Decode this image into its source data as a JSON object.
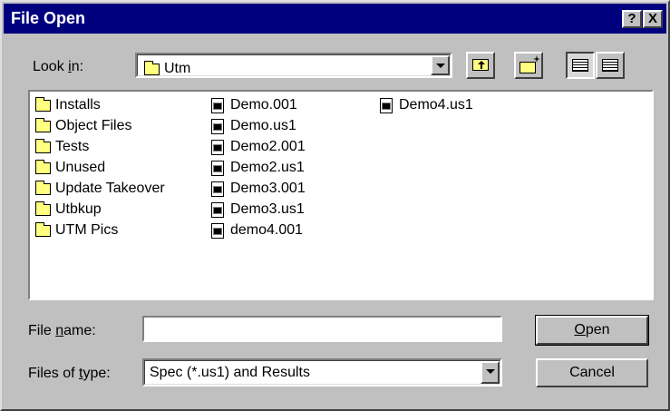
{
  "window": {
    "title": "File Open",
    "help_button": "?",
    "close_button": "X"
  },
  "look_in": {
    "label_pre": "Look ",
    "label_accel": "i",
    "label_post": "n:",
    "value": "Utm"
  },
  "files": {
    "col1": [
      "Installs",
      "Object Files",
      "Tests",
      "Unused",
      "Update Takeover",
      "Utbkup",
      "UTM Pics"
    ],
    "col2": [
      "Demo.001",
      "Demo.us1",
      "Demo2.001",
      "Demo2.us1",
      "Demo3.001",
      "Demo3.us1",
      "demo4.001"
    ],
    "col3": [
      "Demo4.us1"
    ]
  },
  "file_name": {
    "label_pre": "File ",
    "label_accel": "n",
    "label_post": "ame:",
    "value": ""
  },
  "file_type": {
    "label_pre": "Files of ",
    "label_accel": "t",
    "label_post": "ype:",
    "value": "Spec (*.us1) and Results"
  },
  "buttons": {
    "open_accel": "O",
    "open_rest": "pen",
    "cancel": "Cancel"
  },
  "icons": {
    "up": "up-folder-icon",
    "new": "new-folder-icon",
    "list": "list-view-icon",
    "details": "details-view-icon"
  }
}
